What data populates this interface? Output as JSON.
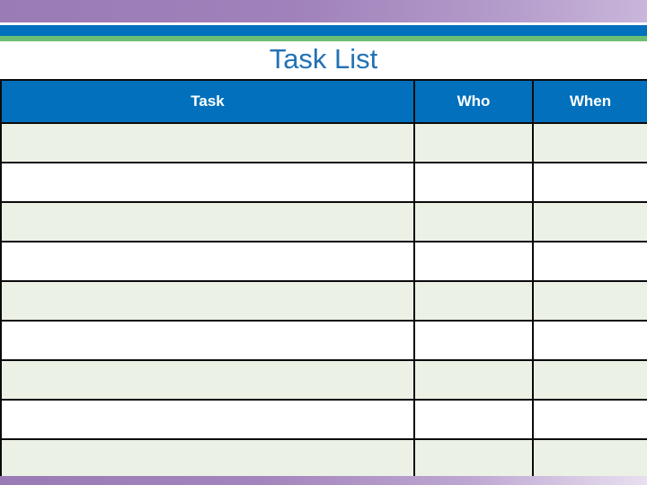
{
  "slide": {
    "title": "Task List",
    "title_color": "#2272b5",
    "background": "#ffffff"
  },
  "decor": {
    "top_purple_color": "#9b7bb5",
    "top_white_color": "#fdfdfd",
    "top_blue_color": "#0270bc",
    "top_green_color": "#6cbe72",
    "bottom_purple_color": "#9b7bb5"
  },
  "table": {
    "header_bg": "#0270bc",
    "header_text_color": "#ffffff",
    "row_tint_color": "#ecf1e6",
    "row_plain_color": "#ffffff",
    "border_color": "#0b0b0b",
    "columns": [
      {
        "key": "task",
        "label": "Task"
      },
      {
        "key": "who",
        "label": "Who"
      },
      {
        "key": "when",
        "label": "When"
      }
    ],
    "rows": [
      {
        "task": "",
        "who": "",
        "when": ""
      },
      {
        "task": "",
        "who": "",
        "when": ""
      },
      {
        "task": "",
        "who": "",
        "when": ""
      },
      {
        "task": "",
        "who": "",
        "when": ""
      },
      {
        "task": "",
        "who": "",
        "when": ""
      },
      {
        "task": "",
        "who": "",
        "when": ""
      },
      {
        "task": "",
        "who": "",
        "when": ""
      },
      {
        "task": "",
        "who": "",
        "when": ""
      },
      {
        "task": "",
        "who": "",
        "when": ""
      }
    ]
  }
}
